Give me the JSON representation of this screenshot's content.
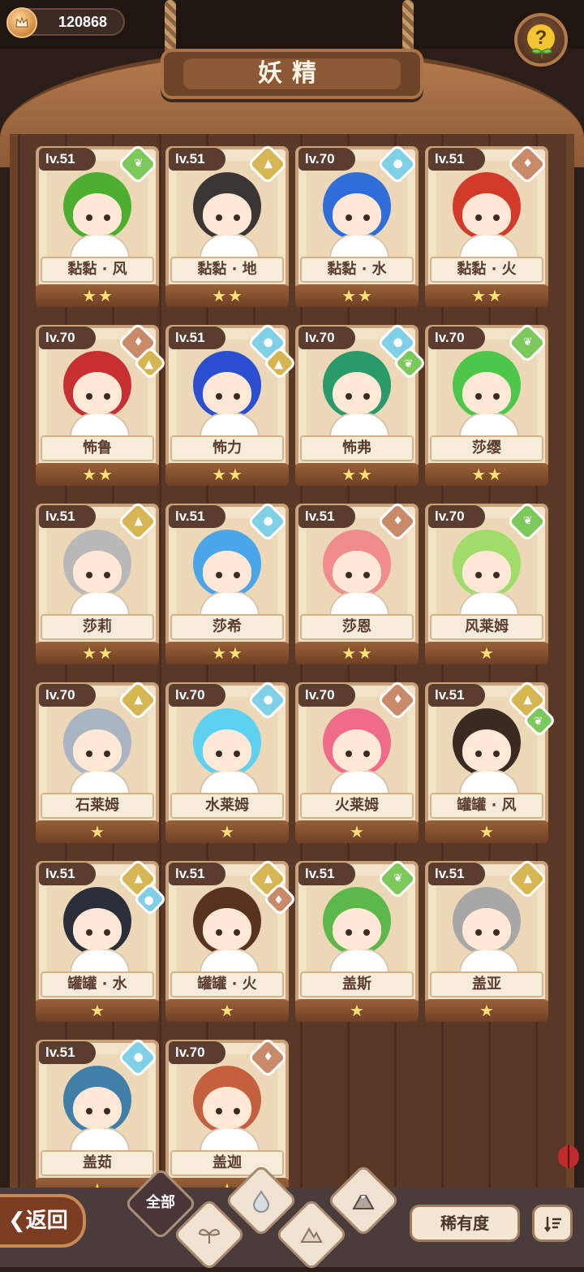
{
  "currency": {
    "amount": "120868"
  },
  "header": {
    "title": "妖精"
  },
  "cards": [
    {
      "level": "lv.51",
      "name": "黏黏 · 风",
      "stars": 2,
      "elements": [
        "wind"
      ],
      "hair": "#4caf2f"
    },
    {
      "level": "lv.51",
      "name": "黏黏 · 地",
      "stars": 2,
      "elements": [
        "earth"
      ],
      "hair": "#3b3633"
    },
    {
      "level": "lv.70",
      "name": "黏黏 · 水",
      "stars": 2,
      "elements": [
        "water"
      ],
      "hair": "#2f6ed9"
    },
    {
      "level": "lv.51",
      "name": "黏黏 · 火",
      "stars": 2,
      "elements": [
        "fire"
      ],
      "hair": "#d23a2a"
    },
    {
      "level": "lv.70",
      "name": "怖鲁",
      "stars": 2,
      "elements": [
        "fire",
        "earth"
      ],
      "hair": "#c82f33"
    },
    {
      "level": "lv.51",
      "name": "怖力",
      "stars": 2,
      "elements": [
        "water",
        "earth"
      ],
      "hair": "#2b4fd0"
    },
    {
      "level": "lv.70",
      "name": "怖弗",
      "stars": 2,
      "elements": [
        "water",
        "wind"
      ],
      "hair": "#2a9a6a"
    },
    {
      "level": "lv.70",
      "name": "莎缨",
      "stars": 2,
      "elements": [
        "wind"
      ],
      "hair": "#4cc74c"
    },
    {
      "level": "lv.51",
      "name": "莎莉",
      "stars": 2,
      "elements": [
        "earth"
      ],
      "hair": "#b8b8b8"
    },
    {
      "level": "lv.51",
      "name": "莎希",
      "stars": 2,
      "elements": [
        "water"
      ],
      "hair": "#4aa6e8"
    },
    {
      "level": "lv.51",
      "name": "莎恩",
      "stars": 2,
      "elements": [
        "fire"
      ],
      "hair": "#f08c8c"
    },
    {
      "level": "lv.70",
      "name": "风莱姆",
      "stars": 1,
      "elements": [
        "wind"
      ],
      "hair": "#9fdc6a"
    },
    {
      "level": "lv.70",
      "name": "石莱姆",
      "stars": 1,
      "elements": [
        "earth"
      ],
      "hair": "#aab4c2"
    },
    {
      "level": "lv.70",
      "name": "水莱姆",
      "stars": 1,
      "elements": [
        "water"
      ],
      "hair": "#5ed0f0"
    },
    {
      "level": "lv.70",
      "name": "火莱姆",
      "stars": 1,
      "elements": [
        "fire"
      ],
      "hair": "#f06a8a"
    },
    {
      "level": "lv.51",
      "name": "罐罐 · 风",
      "stars": 1,
      "elements": [
        "earth",
        "wind"
      ],
      "hair": "#3a2a22"
    },
    {
      "level": "lv.51",
      "name": "罐罐 · 水",
      "stars": 1,
      "elements": [
        "earth",
        "water"
      ],
      "hair": "#2a2f3a"
    },
    {
      "level": "lv.51",
      "name": "罐罐 · 火",
      "stars": 1,
      "elements": [
        "earth",
        "fire"
      ],
      "hair": "#5a3320"
    },
    {
      "level": "lv.51",
      "name": "盖斯",
      "stars": 1,
      "elements": [
        "wind"
      ],
      "hair": "#5cb84a"
    },
    {
      "level": "lv.51",
      "name": "盖亚",
      "stars": 1,
      "elements": [
        "earth"
      ],
      "hair": "#a7a7a7"
    },
    {
      "level": "lv.51",
      "name": "盖茹",
      "stars": 1,
      "elements": [
        "water"
      ],
      "hair": "#3f7fa8"
    },
    {
      "level": "lv.70",
      "name": "盖迦",
      "stars": 1,
      "elements": [
        "fire"
      ],
      "hair": "#c4603e"
    }
  ],
  "element_colors": {
    "wind": "#7cc85a",
    "earth": "#d6b652",
    "water": "#7fd0e6",
    "fire": "#c98a6a"
  },
  "bottom_bar": {
    "back_label": "返回",
    "filter_all_label": "全部",
    "sort_label": "稀有度"
  }
}
